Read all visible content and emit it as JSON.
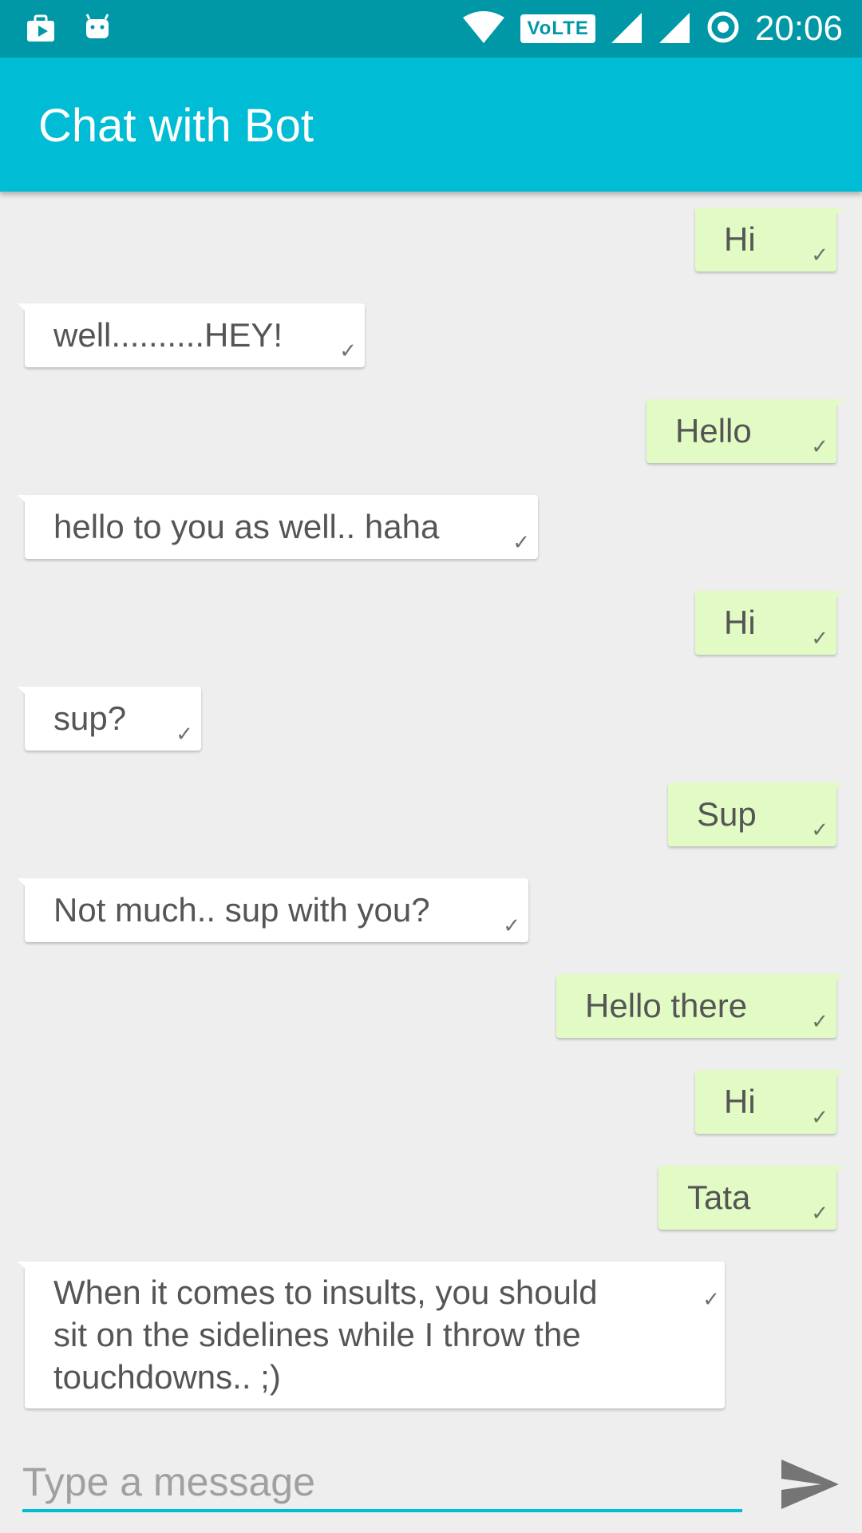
{
  "status_bar": {
    "time": "20:06",
    "volte": "VoLTE"
  },
  "app_bar": {
    "title": "Chat with Bot"
  },
  "messages": [
    {
      "text": "Hi",
      "from": "user"
    },
    {
      "text": "well..........HEY!",
      "from": "bot"
    },
    {
      "text": "Hello",
      "from": "user"
    },
    {
      "text": "hello to you as well.. haha",
      "from": "bot"
    },
    {
      "text": "Hi",
      "from": "user"
    },
    {
      "text": "sup?",
      "from": "bot"
    },
    {
      "text": "Sup",
      "from": "user"
    },
    {
      "text": "Not much.. sup with you?",
      "from": "bot"
    },
    {
      "text": "Hello there",
      "from": "user"
    },
    {
      "text": "Hi",
      "from": "user"
    },
    {
      "text": "Tata",
      "from": "user"
    },
    {
      "text": "When it comes to insults, you should sit on the sidelines while I throw the touchdowns.. ;)",
      "from": "bot"
    }
  ],
  "input": {
    "placeholder": "Type a message",
    "value": ""
  },
  "colors": {
    "status_bar": "#0097a7",
    "app_bar": "#00bcd4",
    "sent_bubble": "#e2fbc5",
    "received_bubble": "#ffffff",
    "background": "#eeeeee"
  },
  "icons": [
    "briefcase-play-icon",
    "android-icon",
    "wifi-icon",
    "signal-icon",
    "sync-icon",
    "check-icon",
    "send-icon"
  ]
}
